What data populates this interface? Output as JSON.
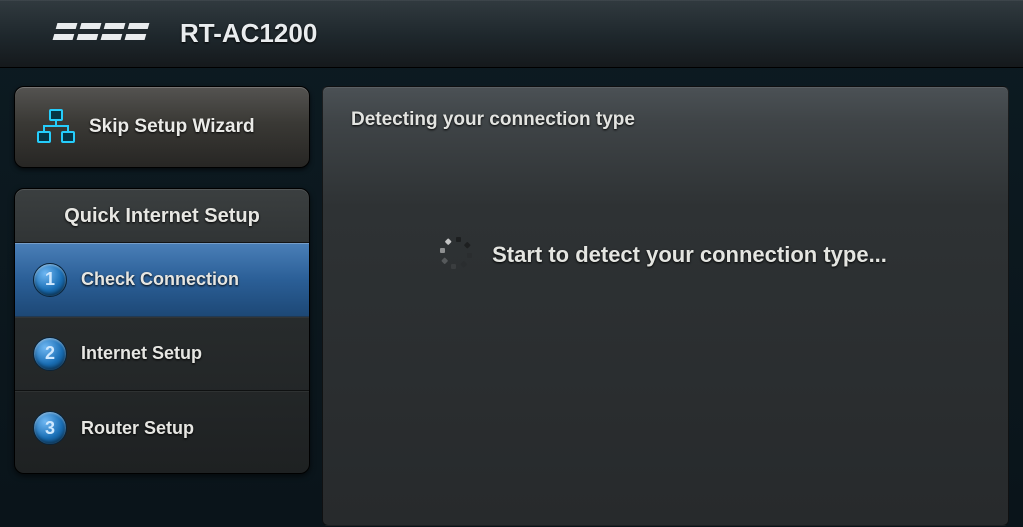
{
  "header": {
    "brand": "ASUS",
    "model": "RT-AC1200"
  },
  "skip": {
    "label": "Skip Setup Wizard"
  },
  "wizard": {
    "title": "Quick Internet Setup",
    "steps": [
      {
        "num": "1",
        "label": "Check Connection",
        "active": true
      },
      {
        "num": "2",
        "label": "Internet Setup",
        "active": false
      },
      {
        "num": "3",
        "label": "Router Setup",
        "active": false
      }
    ]
  },
  "panel": {
    "title": "Detecting your connection type",
    "status": "Start to detect your connection type..."
  }
}
